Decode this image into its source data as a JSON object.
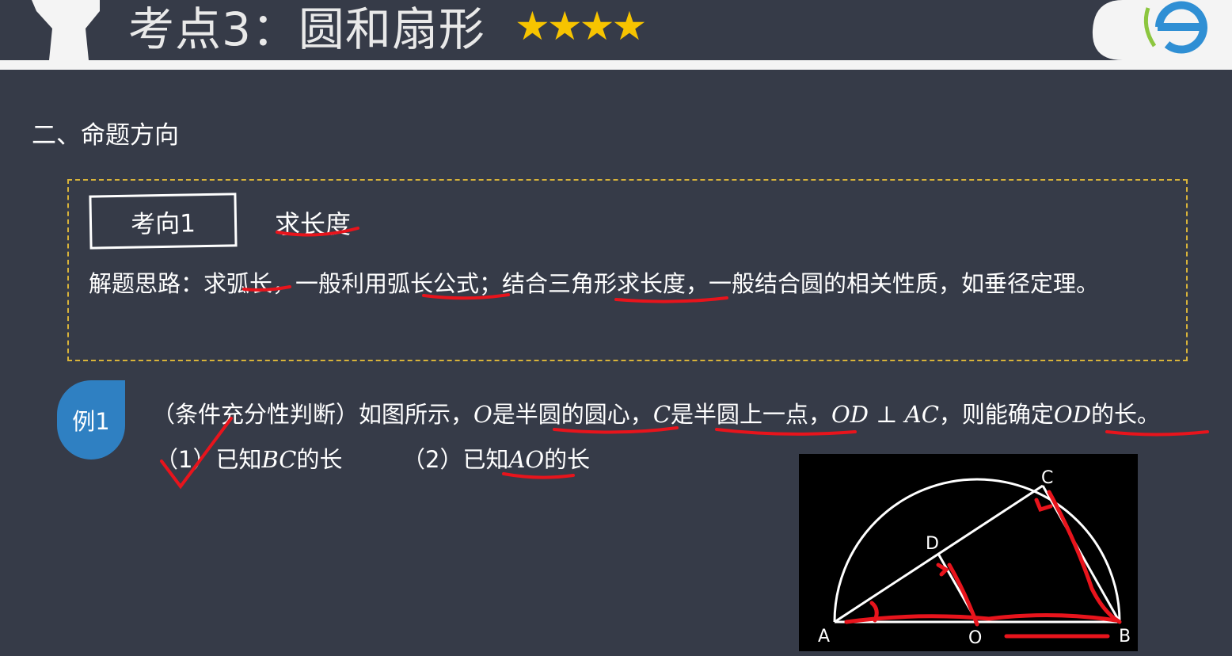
{
  "header": {
    "title": "考点3：圆和扇形",
    "stars": "★★★★",
    "logo_letter": "e"
  },
  "section": {
    "heading": "二、命题方向"
  },
  "direction": {
    "tag": "考向1",
    "title": "求长度",
    "hint": "解题思路：求弧长，一般利用弧长公式；结合三角形求长度，一般结合圆的相关性质，如垂径定理。"
  },
  "example": {
    "badge": "例1",
    "q_part1": "（条件充分性判断）如图所示，",
    "q_O": "O",
    "q_part2": "是半圆的圆心，",
    "q_C": "C",
    "q_part3": "是半圆上一点，",
    "q_cond": "OD ⊥ AC",
    "q_part4": "，则能确定",
    "q_OD": "OD",
    "q_part5": "的长。",
    "opt1_prefix": "（1）已知",
    "opt1_math": "BC",
    "opt1_suffix": "的长",
    "opt2_prefix": "（2）已知",
    "opt2_math": "AO",
    "opt2_suffix": "的长"
  },
  "figure": {
    "labels": {
      "A": "A",
      "B": "B",
      "C": "C",
      "D": "D",
      "O": "O"
    }
  },
  "colors": {
    "background": "#363b48",
    "star": "#f7c400",
    "badge": "#2f80c2",
    "dashed_border": "#d9b43a",
    "annotation": "#e8141c"
  }
}
